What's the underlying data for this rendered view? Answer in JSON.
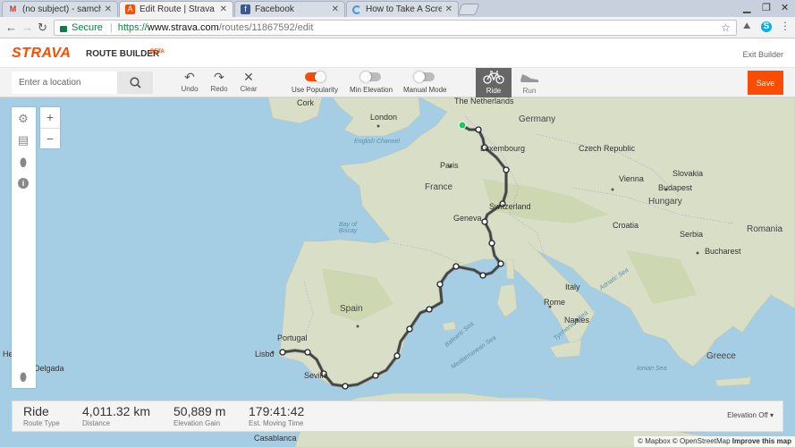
{
  "browser": {
    "tabs": [
      {
        "title": "(no subject) - samchapm",
        "favicon": "gmail-icon",
        "color": "#d93025",
        "glyph": "M"
      },
      {
        "title": "Edit Route | Strava",
        "favicon": "strava-icon",
        "color": "#fc4c02",
        "glyph": "A"
      },
      {
        "title": "Facebook",
        "favicon": "facebook-icon",
        "color": "#3b5998",
        "glyph": "f"
      },
      {
        "title": "How to Take A Screensh",
        "favicon": "loading-icon",
        "color": "#4a90d9",
        "glyph": ""
      }
    ],
    "secure_label": "Secure",
    "url_scheme": "https://",
    "url_host": "www.strava.com",
    "url_path": "/routes/11867592/edit"
  },
  "header": {
    "logo": "STRAVA",
    "product": "ROUTE BUILDER",
    "beta": "BETA",
    "exit": "Exit Builder"
  },
  "toolbar": {
    "search_placeholder": "Enter a location",
    "undo": "Undo",
    "redo": "Redo",
    "clear": "Clear",
    "use_popularity": "Use Popularity",
    "min_elevation": "Min Elevation",
    "manual_mode": "Manual Mode",
    "ride": "Ride",
    "run": "Run",
    "save": "Save",
    "use_popularity_on": true,
    "min_elevation_on": false,
    "manual_mode_on": false
  },
  "map": {
    "labels": {
      "cork": "Cork",
      "netherlands": "The Netherlands",
      "germany": "Germany",
      "london": "London",
      "english_channel": "English Channel",
      "luxembourg": "Luxembourg",
      "czech": "Czech Republic",
      "paris": "Paris",
      "vienna": "Vienna",
      "slovakia": "Slovakia",
      "budapest": "Budapest",
      "france": "France",
      "switzerland": "Switzerland",
      "hungary": "Hungary",
      "bay_of_biscay": "Bay of Biscay",
      "geneva": "Geneva",
      "croatia": "Croatia",
      "romania": "Romania",
      "bucharest": "Bucharest",
      "serbia": "Serbia",
      "adriatic_sea": "Adriatic Sea",
      "spain": "Spain",
      "rome": "Rome",
      "naples": "Naples",
      "tyrrhenian_sea": "Tyrrhenian Sea",
      "balearic_sea": "Balearic Sea",
      "portugal": "Portugal",
      "lisbon": "Lisbo",
      "seville": "Seville",
      "mediterranean": "Mediterranean Sea",
      "greece": "Greece",
      "delgada": "Delgada",
      "helena": "He",
      "casablanca": "Casablanca",
      "ionian_sea": "Ionian Sea",
      "italy": "Italy"
    }
  },
  "stats": {
    "route_type": "Ride",
    "route_type_label": "Route Type",
    "distance": "4,011.32 km",
    "distance_label": "Distance",
    "elevation": "50,889 m",
    "elevation_label": "Elevation Gain",
    "time": "179:41:42",
    "time_label": "Est. Moving Time",
    "elevation_toggle": "Elevation Off"
  },
  "attribution": {
    "mapbox": "© Mapbox",
    "osm": "© OpenStreetMap",
    "improve": "Improve this map"
  }
}
